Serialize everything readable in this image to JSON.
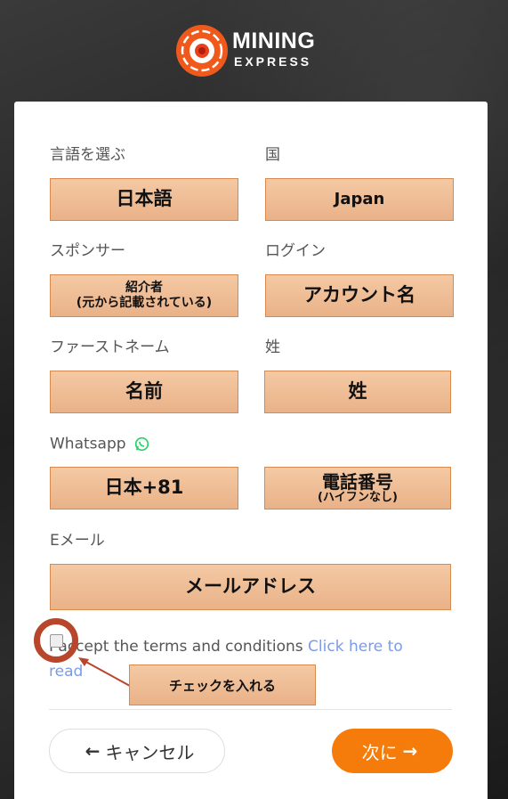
{
  "brand": {
    "line1": "MINING",
    "line2": "EXPRESS"
  },
  "form": {
    "language": {
      "label": "言語を選ぶ",
      "value": "日本語"
    },
    "country": {
      "label": "国",
      "value": "Japan"
    },
    "sponsor": {
      "label": "スポンサー",
      "line1": "紹介者",
      "line2": "(元から記載されている)"
    },
    "login": {
      "label": "ログイン",
      "value": "アカウント名"
    },
    "first_name": {
      "label": "ファーストネーム",
      "value": "名前"
    },
    "last_name": {
      "label": "姓",
      "value": "姓"
    },
    "whatsapp": {
      "label": "Whatsapp",
      "icon": "whatsapp-icon",
      "icon_color": "#25d366"
    },
    "phone_code": {
      "value": "日本+81"
    },
    "phone": {
      "line1": "電話番号",
      "line2": "(ハイフンなし)"
    },
    "email": {
      "label": "Eメール",
      "value": "メールアドレス"
    },
    "terms": {
      "text": "I accept the terms and conditions ",
      "link": "Click here to read"
    },
    "checkbox_checked": false
  },
  "annotation": {
    "callout": "チェックを入れる",
    "color": "#b7462a"
  },
  "buttons": {
    "cancel": {
      "icon": "←",
      "label": "キャンセル"
    },
    "next": {
      "label": "次に",
      "icon": "→",
      "color": "#f57c0a"
    }
  }
}
